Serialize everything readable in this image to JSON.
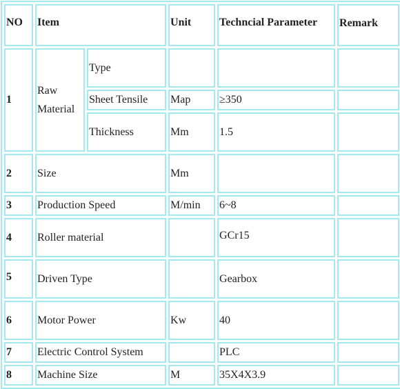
{
  "table": {
    "headers": {
      "no": "NO",
      "item": "Item",
      "unit": "Unit",
      "parameter": "Techncial Parameter",
      "remark": "Remark"
    },
    "rows": [
      {
        "no": "1",
        "item": "Raw Material",
        "sub_rows": [
          {
            "subitem": "Type",
            "unit": "",
            "parameter": "",
            "remark": ""
          },
          {
            "subitem": "Sheet Tensile",
            "unit": "Map",
            "parameter": "≥350",
            "remark": ""
          },
          {
            "subitem": "Thickness",
            "unit": "Mm",
            "parameter": "1.5",
            "remark": ""
          }
        ]
      },
      {
        "no": "2",
        "item": "Size",
        "unit": "Mm",
        "parameter": "",
        "remark": ""
      },
      {
        "no": "3",
        "item": "Production Speed",
        "unit": "M/min",
        "parameter": "6~8",
        "remark": ""
      },
      {
        "no": "4",
        "item": "Roller material",
        "unit": "",
        "parameter": "GCr15",
        "remark": ""
      },
      {
        "no": "5",
        "item": "Driven Type",
        "unit": "",
        "parameter": "Gearbox",
        "remark": ""
      },
      {
        "no": "6",
        "item": "Motor Power",
        "unit": "Kw",
        "parameter": "40",
        "remark": ""
      },
      {
        "no": "7",
        "item": "Electric Control System",
        "unit": "",
        "parameter": "PLC",
        "remark": ""
      },
      {
        "no": "8",
        "item": "Machine Size",
        "unit": "M",
        "parameter": "35X4X3.9",
        "remark": ""
      }
    ]
  },
  "colors": {
    "border": "#a4e9ee",
    "text": "#222222"
  }
}
